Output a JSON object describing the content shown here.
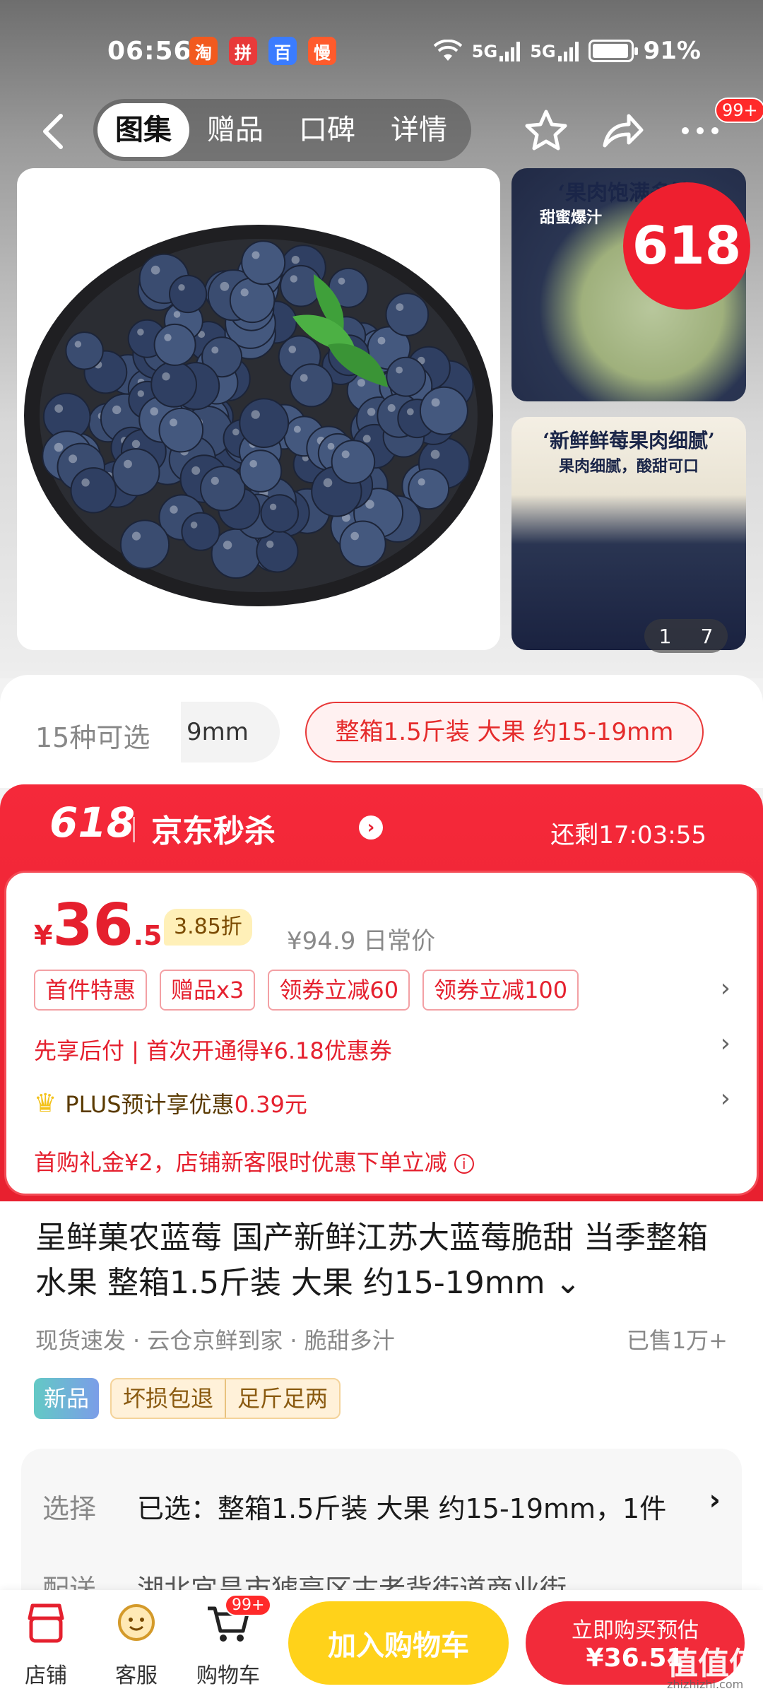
{
  "status_bar": {
    "time": "06:56",
    "network1": "5G",
    "network2": "5G",
    "battery": "91%"
  },
  "nav": {
    "tabs": [
      {
        "label": "图集",
        "active": true
      },
      {
        "label": "赠品",
        "active": false
      },
      {
        "label": "口碑",
        "active": false
      },
      {
        "label": "详情",
        "active": false
      }
    ],
    "more_badge": "99+"
  },
  "gallery": {
    "thumb1_caption": "‘果肉饱满多汁’",
    "thumb1_sub": "甜蜜爆汁",
    "thumb2_caption": "‘新鲜鲜莓果肉细腻’",
    "thumb2_sub": "果肉细腻，酸甜可口",
    "badge": "618",
    "counter_current": "1",
    "counter_total": "7"
  },
  "variants": {
    "count_label": "15种可选",
    "partial_chip": "9mm",
    "selected_chip": "整箱1.5斤装 大果 约15-19mm"
  },
  "promo": {
    "event": "618",
    "brand": "京东秒杀",
    "countdown_label": "还剩",
    "countdown": "17:03:55",
    "price_symbol": "¥",
    "price_int": "36",
    "price_dec": ".51",
    "discount": "3.85折",
    "original_price": "¥94.9",
    "original_label": "日常价",
    "coupons": [
      "首件特惠",
      "赠品x3",
      "领券立减60",
      "领券立减100"
    ],
    "pay_later": "先享后付 | 首次开通得¥6.18优惠券",
    "plus_prefix": "PLUS预计享优惠",
    "plus_amount": "0.39元",
    "gift_line": "首购礼金¥2，店铺新客限时优惠下单立减"
  },
  "product": {
    "title": "呈鲜菓农蓝莓 国产新鲜江苏大蓝莓脆甜 当季整箱水果 整箱1.5斤装 大果 约15-19mm",
    "tags": [
      "现货速发",
      "· 云仓京鲜到家",
      "· 脆甜多汁"
    ],
    "sold": "已售1万+",
    "new_pill": "新品",
    "guarantees": [
      "坏损包退",
      "足斤足两"
    ]
  },
  "selection": {
    "label": "选择",
    "value": "已选：整箱1.5斤装 大果 约15-19mm，1件",
    "ship_label": "配送",
    "ship_value": "湖北宜昌市猇亭区古老背街道商业街"
  },
  "bottom_bar": {
    "shop": "店铺",
    "service": "客服",
    "cart": "购物车",
    "cart_badge": "99+",
    "add_cart": "加入购物车",
    "buy_line1": "立即购买预估",
    "buy_line2": "¥36.51"
  },
  "watermark": {
    "logo": "值值值",
    "url": "zhizhizhi.com"
  },
  "colors": {
    "accent_red": "#e5202e",
    "promo_red": "#f5293a",
    "cart_yellow": "#ffd21a"
  }
}
